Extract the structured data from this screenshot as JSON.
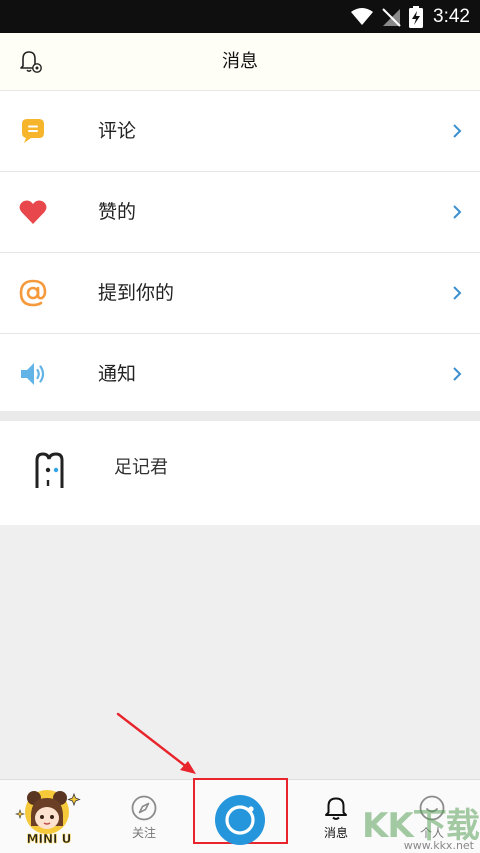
{
  "status_bar": {
    "time": "3:42"
  },
  "header": {
    "title": "消息"
  },
  "menu": {
    "items": [
      {
        "label": "评论",
        "icon": "comment-bubble-icon"
      },
      {
        "label": "赞的",
        "icon": "heart-icon"
      },
      {
        "label": "提到你的",
        "icon": "at-sign-icon"
      },
      {
        "label": "通知",
        "icon": "speaker-icon"
      }
    ]
  },
  "contact": {
    "name": "足记君",
    "avatar": "zuji-logo-avatar"
  },
  "tab_bar": {
    "mini_logo_text": "MINI U",
    "follow_label": "关注",
    "messages_label": "消息",
    "profile_label": "个人"
  },
  "watermark": {
    "main": "KK下载",
    "sub": "www.kkx.net"
  },
  "colors": {
    "comment": "#f7b52c",
    "heart": "#e8474b",
    "at": "#f59a3c",
    "speaker": "#62b3e6",
    "chevron": "#3a8fd0",
    "camera": "#2596dc",
    "highlight": "#e8242c"
  }
}
